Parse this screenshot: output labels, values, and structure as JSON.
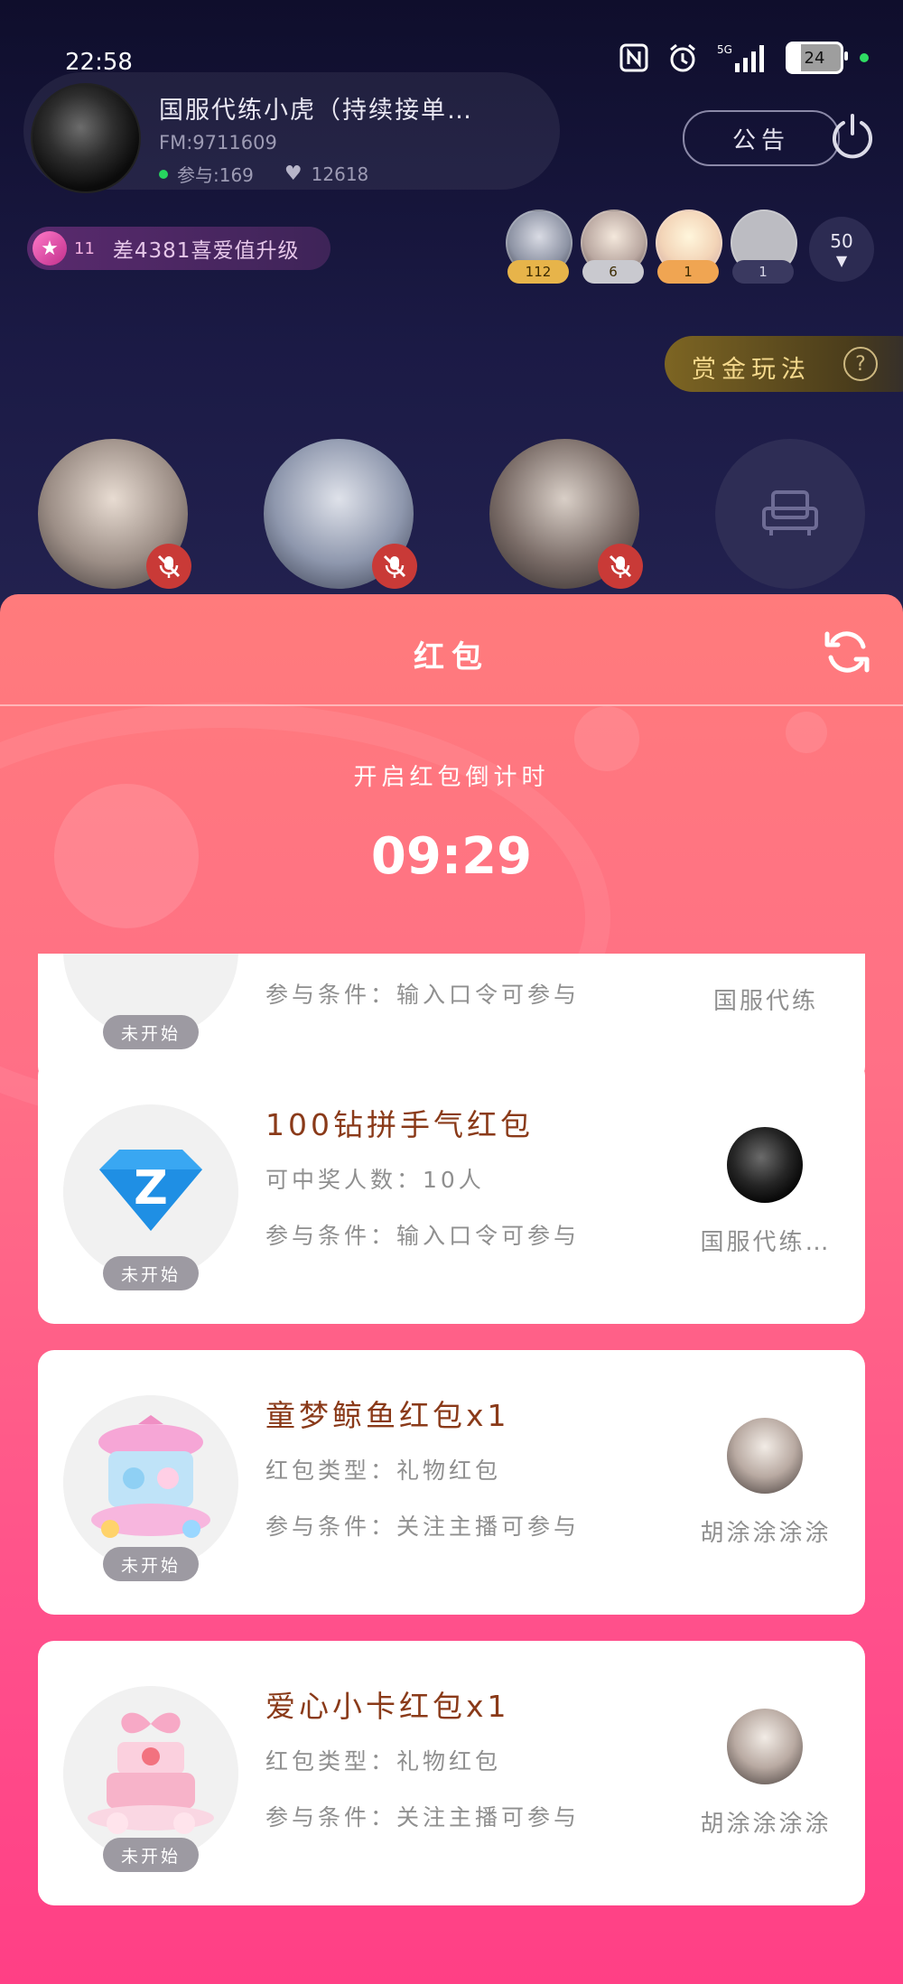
{
  "status_bar": {
    "time": "22:58",
    "battery": "24",
    "network": "5G"
  },
  "room": {
    "title": "国服代练小虎（持续接单…",
    "fm": "FM:9711609",
    "participants_label": "参与:169",
    "likes": "12618",
    "notice_label": "公告"
  },
  "level": {
    "num": "11",
    "text": "差4381喜爱值升级"
  },
  "top_audience": [
    {
      "count": "112",
      "badge_color": "#e7b44a"
    },
    {
      "count": "6",
      "badge_color": "#c9c9cf"
    },
    {
      "count": "1",
      "badge_color": "#f0a552"
    },
    {
      "count": "1",
      "badge_color": "#3a3960"
    }
  ],
  "audience_more": "50",
  "bounty": {
    "label": "赏金玩法",
    "help": "?"
  },
  "sheet": {
    "title": "红包",
    "countdown_label": "开启红包倒计时",
    "countdown": "09:29"
  },
  "packets": [
    {
      "name": "",
      "line1": "",
      "line2": "参与条件：输入口令可参与",
      "sender": "国服代练",
      "state": "未开始"
    },
    {
      "name": "100钻拼手气红包",
      "line1": "可中奖人数：10人",
      "line2": "参与条件：输入口令可参与",
      "sender": "国服代练…",
      "state": "未开始",
      "icon": "diamond-z-icon"
    },
    {
      "name": "童梦鲸鱼红包x1",
      "line1": "红包类型：礼物红包",
      "line2": "参与条件：关注主播可参与",
      "sender": "胡涂涂涂涂",
      "state": "未开始",
      "icon": "carousel-gift-icon"
    },
    {
      "name": "爱心小卡红包x1",
      "line1": "红包类型：礼物红包",
      "line2": "参与条件：关注主播可参与",
      "sender": "胡涂涂涂涂",
      "state": "未开始",
      "icon": "cake-gift-icon"
    }
  ]
}
